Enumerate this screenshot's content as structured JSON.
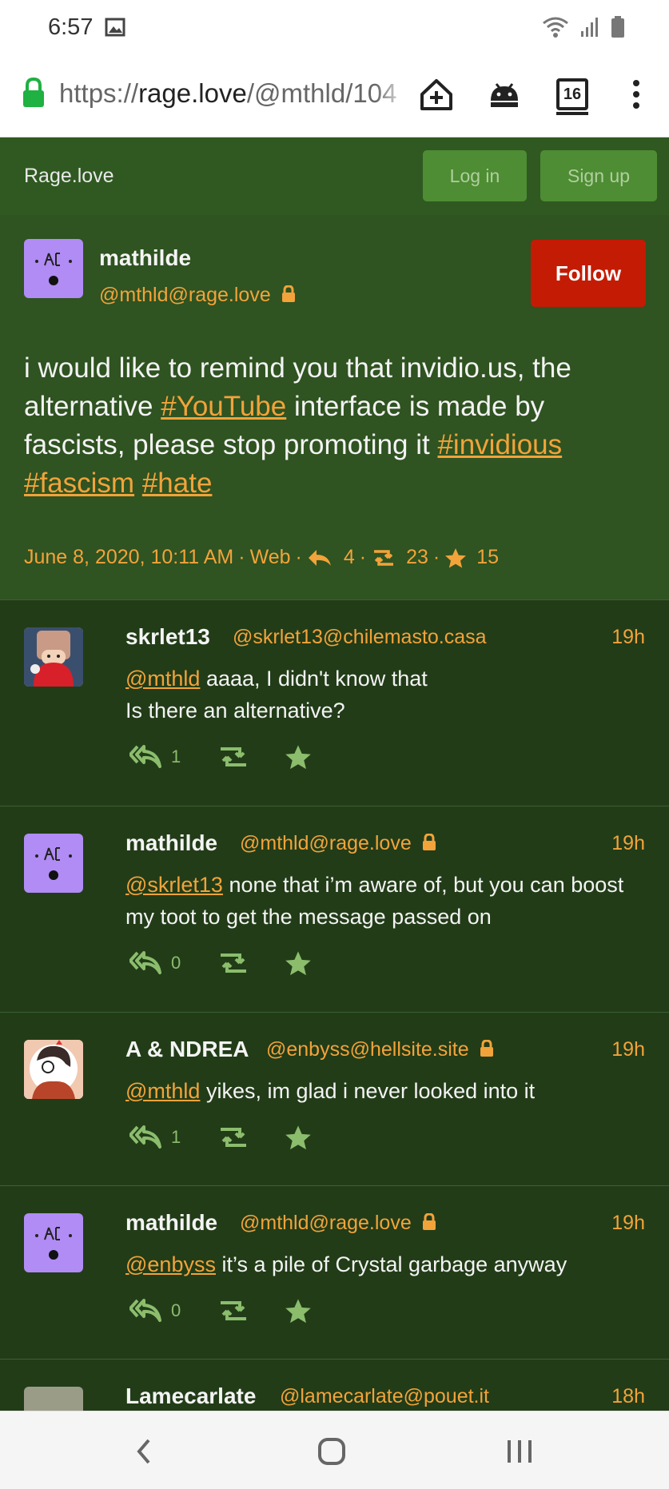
{
  "statusbar": {
    "time": "6:57"
  },
  "browser": {
    "url_prefix": "https://",
    "url_host": "rage.love",
    "url_path": "/@mthld/104",
    "tab_count": "16"
  },
  "header": {
    "brand": "Rage.love",
    "login_label": "Log in",
    "signup_label": "Sign up"
  },
  "main_status": {
    "display_name": "mathilde",
    "acct": "@mthld@rage.love",
    "follow_label": "Follow",
    "content": {
      "text_1": "i would like to remind you that invidio.us, the alternative ",
      "tag_youtube": "#YouTube",
      "text_2": " interface is made by fascists, please stop promoting it ",
      "tag_invidious": "#invidious",
      "tag_fascism": "#fascism",
      "tag_hate": "#hate"
    },
    "date": "June 8, 2020, 10:11 AM",
    "sep": "·",
    "app": "Web",
    "replies": "4",
    "boosts": "23",
    "favourites": "15"
  },
  "replies": [
    {
      "display_name": "skrlet13",
      "acct": "@skrlet13@chilemasto.casa",
      "time": "19h",
      "mention": "@mthld",
      "text": " aaaa, I didn't know that",
      "text_line2": "Is there an alternative?",
      "reply_count": "1"
    },
    {
      "display_name": "mathilde",
      "acct": "@mthld@rage.love",
      "time": "19h",
      "mention": "@skrlet13",
      "text": " none that i’m aware of, but you can boost my toot to get the message passed on",
      "reply_count": "0"
    },
    {
      "display_name": "A & NDREA",
      "acct": "@enbyss@hellsite.site",
      "time": "19h",
      "mention": "@mthld",
      "text": " yikes, im glad i never looked into it",
      "reply_count": "1"
    },
    {
      "display_name": "mathilde",
      "acct": "@mthld@rage.love",
      "time": "19h",
      "mention": "@enbyss",
      "text": " it’s a pile of Crystal garbage anyway",
      "reply_count": "0"
    },
    {
      "display_name": "Lamecarlate",
      "acct": "@lamecarlate@pouet.it",
      "time": "18h"
    }
  ],
  "colors": {
    "accent": "#f2a33a",
    "background": "#223c18",
    "header": "#2f5921",
    "follow": "#c31b04",
    "action": "#8bbd6d"
  }
}
